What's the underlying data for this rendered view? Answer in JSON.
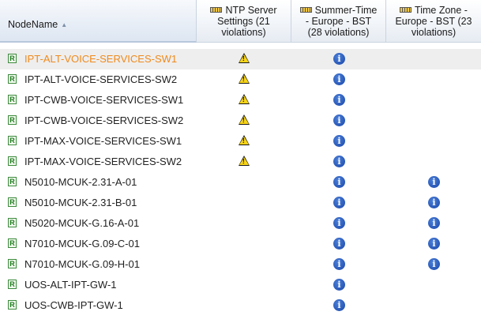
{
  "header": {
    "name_col": "NodeName",
    "sort_icon": "sort-ascending-icon",
    "col1": {
      "line1": "NTP Server",
      "line2": "Settings (21",
      "line3": "violations)"
    },
    "col2": {
      "line1": "Summer-Time",
      "line2": "- Europe - BST",
      "line3": "(28 violations)"
    },
    "col3": {
      "line1": "Time Zone -",
      "line2": "Europe - BST (23",
      "line3": "violations)"
    }
  },
  "icons": {
    "node": "router-node-icon",
    "warning": "warning-icon",
    "info": "info-icon",
    "ruler": "ruler-icon"
  },
  "colors": {
    "selected_text": "#f08a1c",
    "selected_row_bg": "#eeeeee",
    "info_blue": "#1a46a8",
    "warning_yellow": "#f7d417"
  },
  "rows": [
    {
      "name": "IPT-ALT-VOICE-SERVICES-SW1",
      "col1": "warning",
      "col2": "info",
      "col3": "",
      "selected": true
    },
    {
      "name": "IPT-ALT-VOICE-SERVICES-SW2",
      "col1": "warning",
      "col2": "info",
      "col3": ""
    },
    {
      "name": "IPT-CWB-VOICE-SERVICES-SW1",
      "col1": "warning",
      "col2": "info",
      "col3": ""
    },
    {
      "name": "IPT-CWB-VOICE-SERVICES-SW2",
      "col1": "warning",
      "col2": "info",
      "col3": ""
    },
    {
      "name": "IPT-MAX-VOICE-SERVICES-SW1",
      "col1": "warning",
      "col2": "info",
      "col3": ""
    },
    {
      "name": "IPT-MAX-VOICE-SERVICES-SW2",
      "col1": "warning",
      "col2": "info",
      "col3": ""
    },
    {
      "name": "N5010-MCUK-2.31-A-01",
      "col1": "",
      "col2": "info",
      "col3": "info"
    },
    {
      "name": "N5010-MCUK-2.31-B-01",
      "col1": "",
      "col2": "info",
      "col3": "info"
    },
    {
      "name": "N5020-MCUK-G.16-A-01",
      "col1": "",
      "col2": "info",
      "col3": "info"
    },
    {
      "name": "N7010-MCUK-G.09-C-01",
      "col1": "",
      "col2": "info",
      "col3": "info"
    },
    {
      "name": "N7010-MCUK-G.09-H-01",
      "col1": "",
      "col2": "info",
      "col3": "info"
    },
    {
      "name": "UOS-ALT-IPT-GW-1",
      "col1": "",
      "col2": "info",
      "col3": ""
    },
    {
      "name": "UOS-CWB-IPT-GW-1",
      "col1": "",
      "col2": "info",
      "col3": ""
    }
  ]
}
